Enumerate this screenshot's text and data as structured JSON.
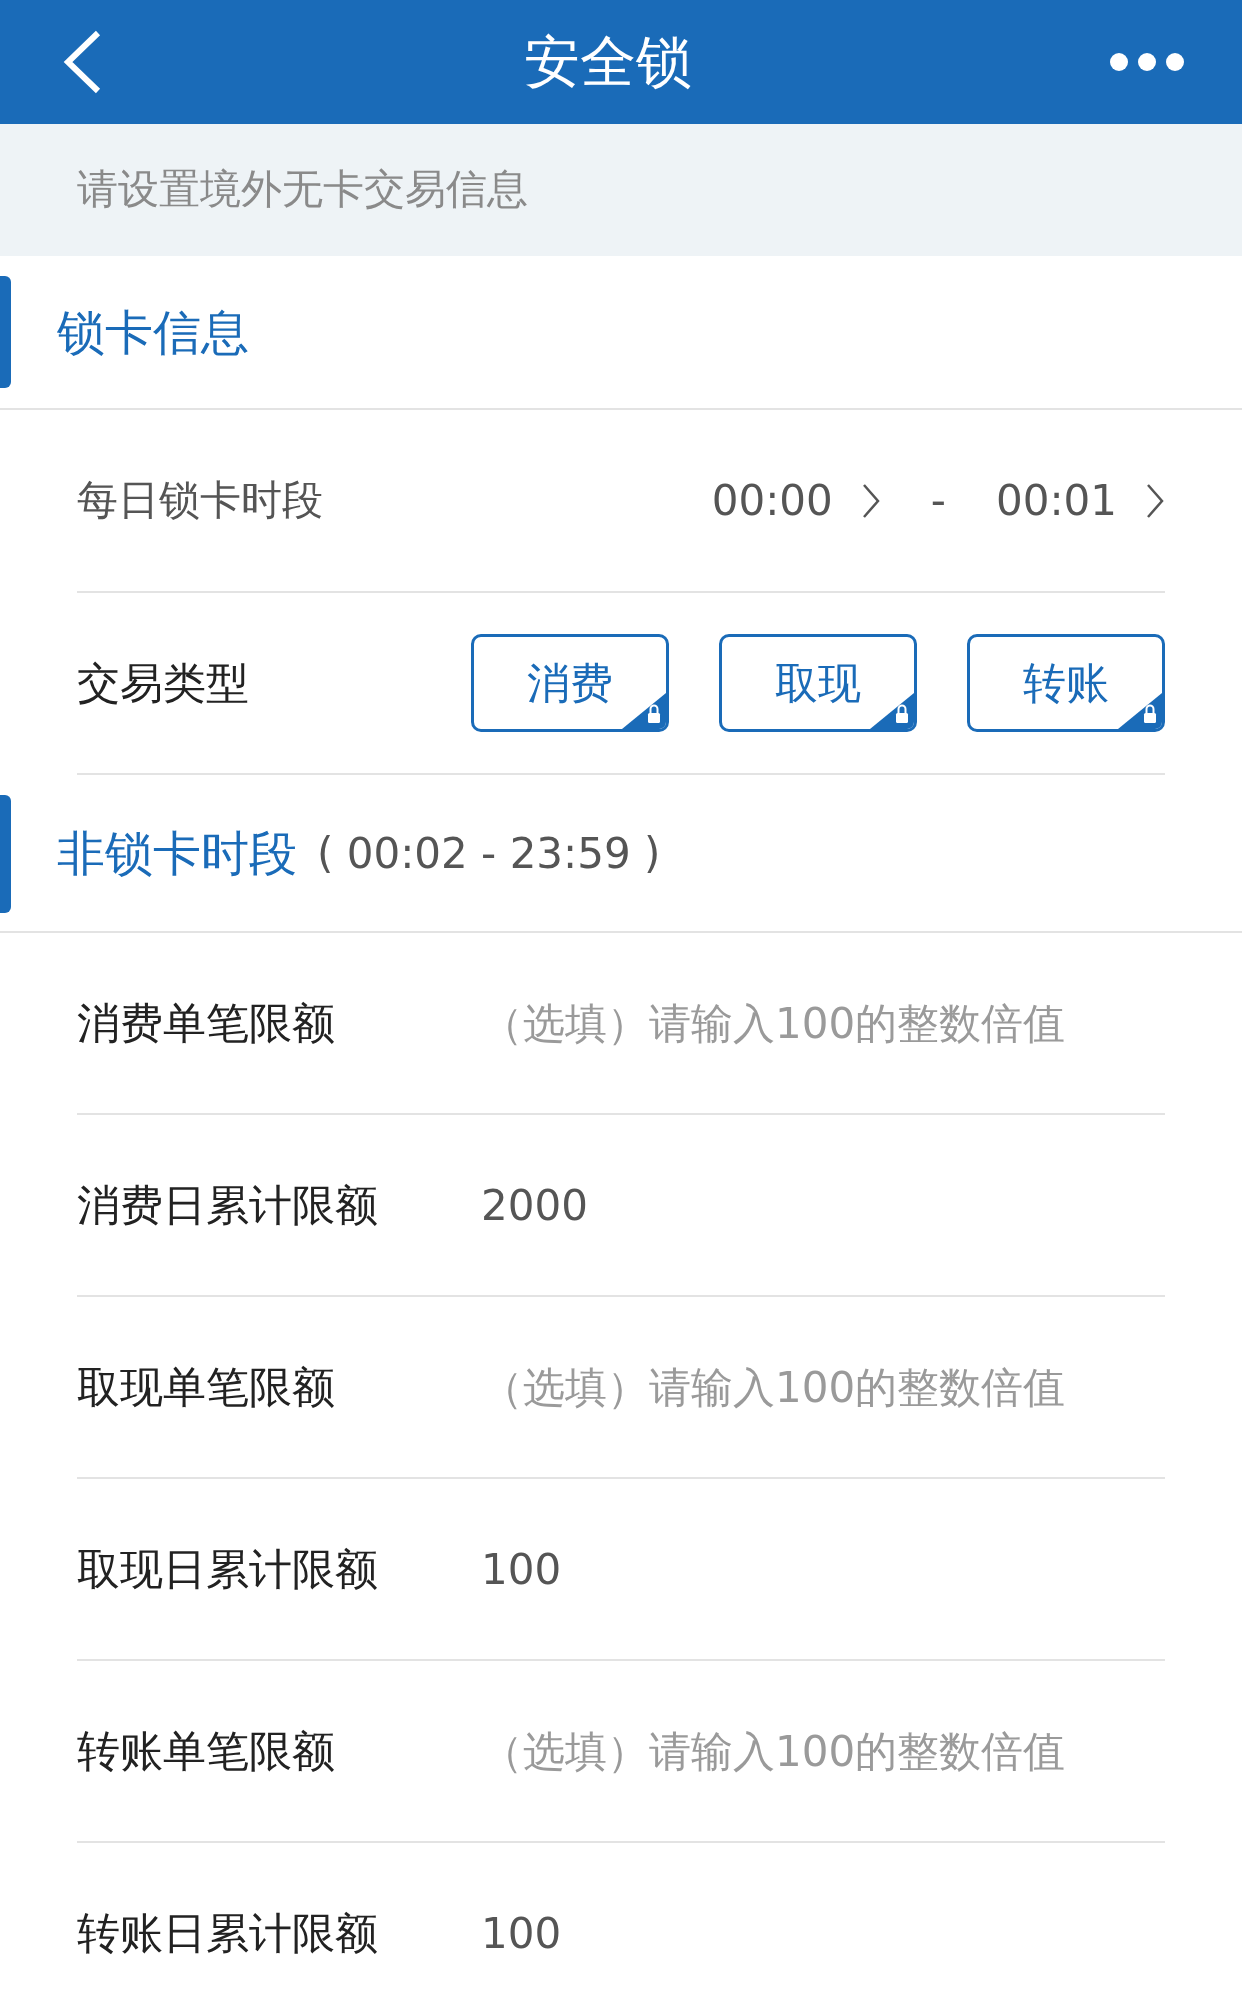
{
  "header": {
    "title": "安全锁"
  },
  "notice": "请设置境外无卡交易信息",
  "lock_section": {
    "title": "锁卡信息",
    "daily_period": {
      "label": "每日锁卡时段",
      "start": "00:00",
      "separator": "-",
      "end": "00:01"
    },
    "transaction_type": {
      "label": "交易类型",
      "options": [
        {
          "label": "消费",
          "locked": true
        },
        {
          "label": "取现",
          "locked": true
        },
        {
          "label": "转账",
          "locked": true
        }
      ]
    }
  },
  "unlock_section": {
    "title": "非锁卡时段",
    "range": "( 00:02 - 23:59 )",
    "fields": [
      {
        "label": "消费单笔限额",
        "placeholder": "（选填）请输入100的整数倍值"
      },
      {
        "label": "消费日累计限额",
        "value": "2000"
      },
      {
        "label": "取现单笔限额",
        "placeholder": "（选填）请输入100的整数倍值"
      },
      {
        "label": "取现日累计限额",
        "value": "100"
      },
      {
        "label": "转账单笔限额",
        "placeholder": "（选填）请输入100的整数倍值"
      },
      {
        "label": "转账日累计限额",
        "value": "100"
      }
    ]
  }
}
